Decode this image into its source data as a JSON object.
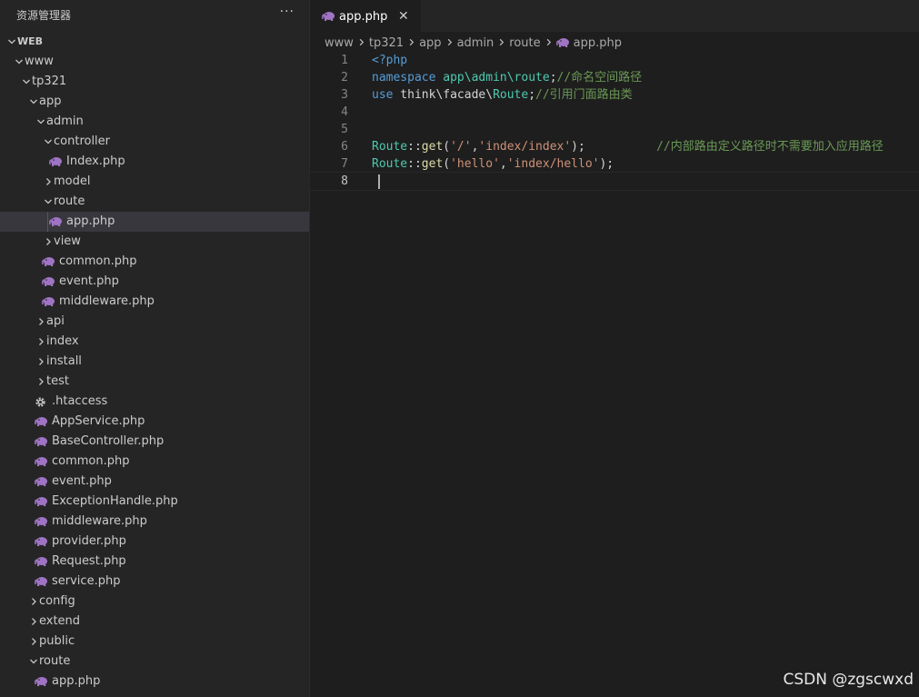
{
  "explorer": {
    "title": "资源管理器",
    "more_label": "···",
    "tree": [
      {
        "name": "tree-folder-web",
        "label": "WEB",
        "depth": 0,
        "type": "root",
        "open": true
      },
      {
        "name": "tree-folder-www",
        "label": "www",
        "depth": 1,
        "type": "folder",
        "open": true
      },
      {
        "name": "tree-folder-tp321",
        "label": "tp321",
        "depth": 2,
        "type": "folder",
        "open": true
      },
      {
        "name": "tree-folder-app",
        "label": "app",
        "depth": 3,
        "type": "folder",
        "open": true
      },
      {
        "name": "tree-folder-admin",
        "label": "admin",
        "depth": 4,
        "type": "folder",
        "open": true
      },
      {
        "name": "tree-folder-controller",
        "label": "controller",
        "depth": 5,
        "type": "folder",
        "open": true
      },
      {
        "name": "tree-file-index-php",
        "label": "Index.php",
        "depth": 6,
        "type": "php"
      },
      {
        "name": "tree-folder-model",
        "label": "model",
        "depth": 5,
        "type": "folder",
        "open": false
      },
      {
        "name": "tree-folder-route",
        "label": "route",
        "depth": 5,
        "type": "folder",
        "open": true
      },
      {
        "name": "tree-file-app-php",
        "label": "app.php",
        "depth": 6,
        "type": "php",
        "selected": true
      },
      {
        "name": "tree-folder-view",
        "label": "view",
        "depth": 5,
        "type": "folder",
        "open": false
      },
      {
        "name": "tree-file-common-php",
        "label": "common.php",
        "depth": 5,
        "type": "php"
      },
      {
        "name": "tree-file-event-php",
        "label": "event.php",
        "depth": 5,
        "type": "php"
      },
      {
        "name": "tree-file-middleware-php",
        "label": "middleware.php",
        "depth": 5,
        "type": "php"
      },
      {
        "name": "tree-folder-api",
        "label": "api",
        "depth": 4,
        "type": "folder",
        "open": false
      },
      {
        "name": "tree-folder-index",
        "label": "index",
        "depth": 4,
        "type": "folder",
        "open": false
      },
      {
        "name": "tree-folder-install",
        "label": "install",
        "depth": 4,
        "type": "folder",
        "open": false
      },
      {
        "name": "tree-folder-test",
        "label": "test",
        "depth": 4,
        "type": "folder",
        "open": false
      },
      {
        "name": "tree-file-htaccess",
        "label": ".htaccess",
        "depth": 4,
        "type": "gear"
      },
      {
        "name": "tree-file-appservice-php",
        "label": "AppService.php",
        "depth": 4,
        "type": "php"
      },
      {
        "name": "tree-file-basecontroller-php",
        "label": "BaseController.php",
        "depth": 4,
        "type": "php"
      },
      {
        "name": "tree-file-common-php-2",
        "label": "common.php",
        "depth": 4,
        "type": "php"
      },
      {
        "name": "tree-file-event-php-2",
        "label": "event.php",
        "depth": 4,
        "type": "php"
      },
      {
        "name": "tree-file-exceptionhandle-php",
        "label": "ExceptionHandle.php",
        "depth": 4,
        "type": "php"
      },
      {
        "name": "tree-file-middleware-php-2",
        "label": "middleware.php",
        "depth": 4,
        "type": "php"
      },
      {
        "name": "tree-file-provider-php",
        "label": "provider.php",
        "depth": 4,
        "type": "php"
      },
      {
        "name": "tree-file-request-php",
        "label": "Request.php",
        "depth": 4,
        "type": "php"
      },
      {
        "name": "tree-file-service-php",
        "label": "service.php",
        "depth": 4,
        "type": "php"
      },
      {
        "name": "tree-folder-config",
        "label": "config",
        "depth": 3,
        "type": "folder",
        "open": false
      },
      {
        "name": "tree-folder-extend",
        "label": "extend",
        "depth": 3,
        "type": "folder",
        "open": false
      },
      {
        "name": "tree-folder-public",
        "label": "public",
        "depth": 3,
        "type": "folder",
        "open": false
      },
      {
        "name": "tree-folder-route-root",
        "label": "route",
        "depth": 3,
        "type": "folder",
        "open": true
      },
      {
        "name": "tree-file-app-php-root",
        "label": "app.php",
        "depth": 4,
        "type": "php"
      }
    ]
  },
  "tab": {
    "label": "app.php",
    "close_label": "✕"
  },
  "breadcrumb": [
    "www",
    "tp321",
    "app",
    "admin",
    "route",
    "app.php"
  ],
  "code": {
    "current_line": 8,
    "lines": [
      {
        "n": "1",
        "tokens": [
          {
            "t": "<?php",
            "c": "k-tag"
          }
        ]
      },
      {
        "n": "2",
        "tokens": [
          {
            "t": "namespace",
            "c": "k-kw"
          },
          {
            "t": " ",
            "c": "k-op"
          },
          {
            "t": "app\\admin\\route",
            "c": "k-ns"
          },
          {
            "t": ";",
            "c": "k-op"
          },
          {
            "t": "//命名空间路径",
            "c": "k-cm"
          }
        ]
      },
      {
        "n": "3",
        "tokens": [
          {
            "t": "use",
            "c": "k-kw"
          },
          {
            "t": " think\\facade\\",
            "c": "k-id"
          },
          {
            "t": "Route",
            "c": "k-cls"
          },
          {
            "t": ";",
            "c": "k-op"
          },
          {
            "t": "//引用门面路由类",
            "c": "k-cm"
          }
        ]
      },
      {
        "n": "4",
        "tokens": []
      },
      {
        "n": "5",
        "tokens": []
      },
      {
        "n": "6",
        "tokens": [
          {
            "t": "Route",
            "c": "k-cls"
          },
          {
            "t": "::",
            "c": "k-op"
          },
          {
            "t": "get",
            "c": "k-fn"
          },
          {
            "t": "(",
            "c": "k-op"
          },
          {
            "t": "'/'",
            "c": "k-str"
          },
          {
            "t": ",",
            "c": "k-op"
          },
          {
            "t": "'index/index'",
            "c": "k-str"
          },
          {
            "t": ");          ",
            "c": "k-op"
          },
          {
            "t": "//内部路由定义路径时不需要加入应用路径",
            "c": "k-cm"
          }
        ]
      },
      {
        "n": "7",
        "tokens": [
          {
            "t": "Route",
            "c": "k-cls"
          },
          {
            "t": "::",
            "c": "k-op"
          },
          {
            "t": "get",
            "c": "k-fn"
          },
          {
            "t": "(",
            "c": "k-op"
          },
          {
            "t": "'hello'",
            "c": "k-str"
          },
          {
            "t": ",",
            "c": "k-op"
          },
          {
            "t": "'index/hello'",
            "c": "k-str"
          },
          {
            "t": ");",
            "c": "k-op"
          }
        ]
      },
      {
        "n": "8",
        "tokens": []
      }
    ]
  },
  "watermark": "CSDN @zgscwxd",
  "colors": {
    "php_icon": "#a074c4",
    "gear_icon": "#c5c5c5",
    "chevron": "#c5c5c5"
  }
}
